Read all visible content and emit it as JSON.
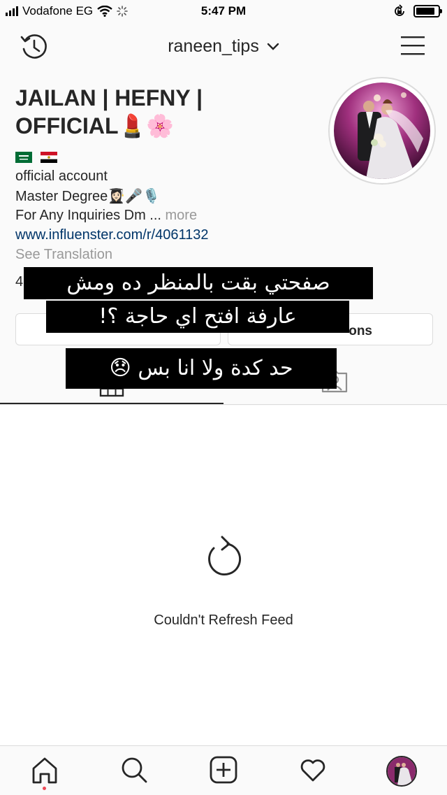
{
  "status_bar": {
    "carrier": "Vodafone EG",
    "time": "5:47 PM",
    "battery_level": 0.85
  },
  "nav": {
    "username": "raneen_tips",
    "history_icon": "history-clock-icon",
    "dropdown_icon": "chevron-down-icon",
    "menu_icon": "hamburger-menu-icon"
  },
  "profile": {
    "display_name_line1": "JAILAN | HEFNY |",
    "display_name_line2": "OFFICIAL",
    "display_name_emojis": "💄🌸",
    "flags": [
      "saudi-arabia-flag-icon",
      "egypt-flag-icon"
    ],
    "bio": {
      "line1": "official account",
      "line2": "Master Degree",
      "line2_emojis": "👩🏻‍🎓🎤🎙️",
      "line3": "For Any Inquiries Dm ...",
      "more": " more",
      "website": "www.influenster.com/r/4061132",
      "see_translation": "See Translation"
    },
    "stats_peek": "4",
    "contact_button_partial": "ons"
  },
  "captions": {
    "line1": "صفحتي بقت بالمنظر ده ومش",
    "line2": "عارفة افتح اي حاجة ؟!",
    "line3": "حد كدة ولا انا بس",
    "line3_emoji": "😞"
  },
  "feed": {
    "refresh_icon": "refresh-icon",
    "error_message": "Couldn't Refresh Feed"
  },
  "tabbar": {
    "items": [
      "home-icon",
      "search-icon",
      "new-post-icon",
      "activity-heart-icon",
      "profile-avatar"
    ],
    "active": "home-icon"
  },
  "colors": {
    "background": "#fafafa",
    "text": "#262626",
    "link": "#003569",
    "muted": "#999999",
    "border": "#dbdbdb",
    "notification_dot": "#ed4956",
    "caption_bg": "#000000"
  }
}
